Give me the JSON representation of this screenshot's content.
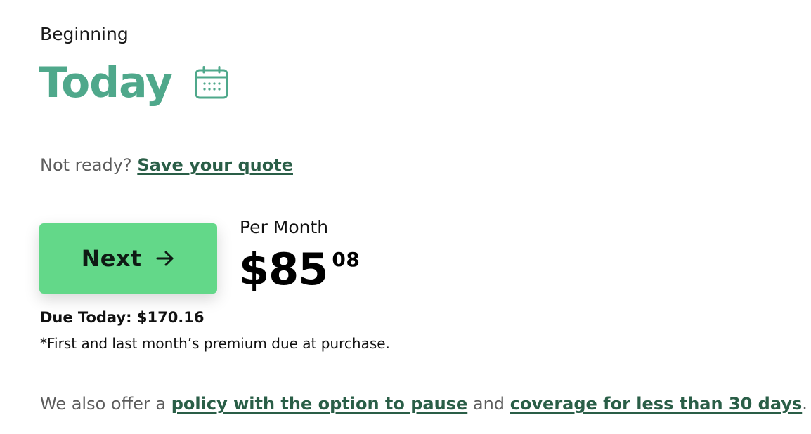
{
  "start": {
    "label": "Beginning",
    "date_value": "Today",
    "calendar_icon": "calendar-icon",
    "accent_color": "#4fa88b"
  },
  "save_quote": {
    "prompt": "Not ready?",
    "link_label": "Save your quote"
  },
  "next_button": {
    "label": "Next",
    "icon": "arrow-right-icon",
    "background_color": "#63d889"
  },
  "pricing": {
    "period_label": "Per Month",
    "price_main": "$85",
    "price_cents": "08",
    "due_today": "Due Today: $170.16",
    "due_note": "*First and last month’s premium due at purchase."
  },
  "other_options": {
    "prefix": "We also offer a",
    "link1_label": "policy with the option to pause",
    "connector": "and",
    "link2_label": "coverage for less than 30 days",
    "suffix": ".",
    "link_color": "#2a5e47"
  }
}
